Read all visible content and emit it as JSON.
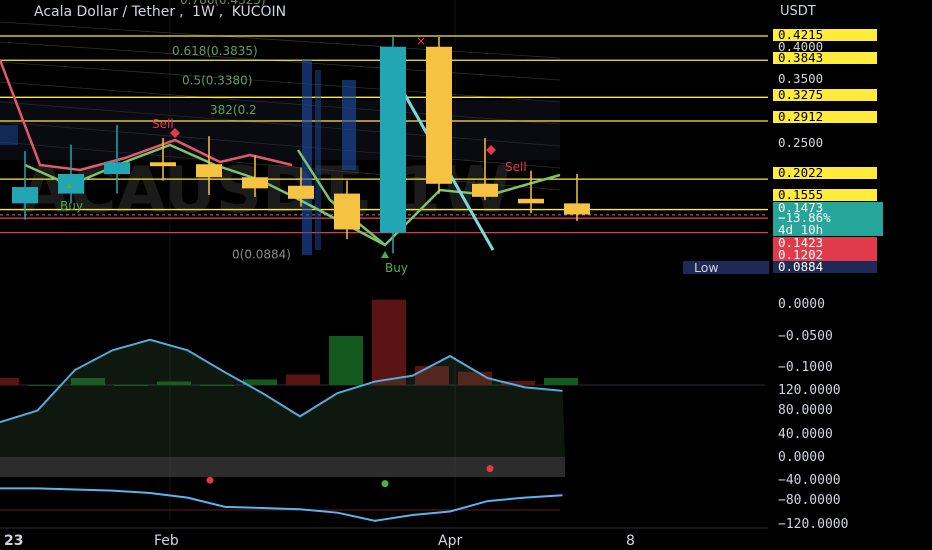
{
  "header": {
    "symbol": "Acala Dollar / Tether",
    "interval": "1W",
    "exchange": "KUCOIN",
    "currency": "USDT"
  },
  "colors": {
    "up": "#22a6b3",
    "down": "#f5c242",
    "fib_line": "#ffeb3b",
    "current_line": "#e03a4b",
    "sell": "#e03a4b",
    "buy": "#4caf50",
    "osc_line": "#5ab4f0",
    "hist_up": "#145a1f",
    "hist_down": "#5a1414"
  },
  "chart_data": [
    {
      "type": "candlestick",
      "title": "Acala Dollar / Tether, 1W, KUCOIN",
      "x_ticks": [
        "23",
        "Feb",
        "Apr",
        "8"
      ],
      "candles": [
        {
          "o": 0.165,
          "h": 0.245,
          "l": 0.14,
          "c": 0.19
        },
        {
          "o": 0.18,
          "h": 0.255,
          "l": 0.165,
          "c": 0.21
        },
        {
          "o": 0.21,
          "h": 0.285,
          "l": 0.18,
          "c": 0.228
        },
        {
          "o": 0.228,
          "h": 0.265,
          "l": 0.2,
          "c": 0.222
        },
        {
          "o": 0.225,
          "h": 0.268,
          "l": 0.178,
          "c": 0.205
        },
        {
          "o": 0.205,
          "h": 0.238,
          "l": 0.175,
          "c": 0.188
        },
        {
          "o": 0.192,
          "h": 0.22,
          "l": 0.16,
          "c": 0.172
        },
        {
          "o": 0.18,
          "h": 0.2,
          "l": 0.11,
          "c": 0.125
        },
        {
          "o": 0.12,
          "h": 0.42,
          "l": 0.0884,
          "c": 0.405
        },
        {
          "o": 0.405,
          "h": 0.42,
          "l": 0.18,
          "c": 0.195
        },
        {
          "o": 0.195,
          "h": 0.265,
          "l": 0.17,
          "c": 0.175
        },
        {
          "o": 0.172,
          "h": 0.215,
          "l": 0.15,
          "c": 0.165
        },
        {
          "o": 0.165,
          "h": 0.21,
          "l": 0.138,
          "c": 0.148
        }
      ],
      "fib_levels": [
        {
          "label": "0.618(0.3835)",
          "value": 0.3835
        },
        {
          "label": "0.5(0.3380)",
          "value": 0.338
        },
        {
          "label": "382(0.2",
          "value": 0.2924
        },
        {
          "label": "0(0.0884)",
          "value": 0.0884
        }
      ],
      "horizontal_levels": [
        0.4215,
        0.3843,
        0.3275,
        0.2912,
        0.2022,
        0.1555
      ],
      "price_labels": [
        {
          "text": "0.4215",
          "kind": "fib"
        },
        {
          "text": "0.4000",
          "kind": "axis"
        },
        {
          "text": "0.3843",
          "kind": "fib"
        },
        {
          "text": "0.3500",
          "kind": "axis"
        },
        {
          "text": "0.3275",
          "kind": "fib"
        },
        {
          "text": "0.2912",
          "kind": "fib"
        },
        {
          "text": "0.2500",
          "kind": "axis"
        },
        {
          "text": "0.2022",
          "kind": "fib"
        },
        {
          "text": "0.1555",
          "kind": "fib"
        },
        {
          "text": "0.1473",
          "kind": "current"
        },
        {
          "text": "−13.86%",
          "kind": "current"
        },
        {
          "text": "4d 10h",
          "kind": "current"
        },
        {
          "text": "0.1423",
          "kind": "red"
        },
        {
          "text": "0.1202",
          "kind": "red"
        },
        {
          "text": "0.0884",
          "kind": "low"
        }
      ],
      "low_tag": "Low",
      "signals": [
        {
          "text": "Buy",
          "kind": "buy"
        },
        {
          "text": "Sell",
          "kind": "sell"
        },
        {
          "text": "Buy",
          "kind": "buy"
        },
        {
          "text": "Sell",
          "kind": "sell"
        }
      ],
      "watermark": "ACAUSDT, 1W"
    },
    {
      "type": "bar",
      "title": "",
      "y_ticks": [
        "0.0000",
        "−0.0500",
        "−0.1000"
      ],
      "values": [
        -0.01,
        0,
        0.01,
        0,
        0.005,
        0,
        0.008,
        -0.015,
        0.07,
        -0.122,
        -0.027,
        -0.019,
        -0.006,
        0.01
      ]
    },
    {
      "type": "line",
      "title": "",
      "y_ticks": [
        "120.0000",
        "80.0000",
        "40.0000",
        "0.0000",
        "−40.0000",
        "−80.0000",
        "−120.0000"
      ],
      "series": [
        {
          "values": [
            30,
            40,
            75,
            92,
            101,
            92,
            73,
            55,
            35,
            55,
            65,
            70,
            87,
            68,
            60,
            57
          ]
        },
        {
          "values": [
            -27,
            -27,
            -28,
            -29,
            -31,
            -35,
            -43,
            -44,
            -45,
            -48,
            -55,
            -50,
            -47,
            -38,
            -35,
            -33
          ]
        }
      ],
      "markers": [
        {
          "kind": "sell"
        },
        {
          "kind": "buy"
        },
        {
          "kind": "sell"
        }
      ]
    }
  ]
}
